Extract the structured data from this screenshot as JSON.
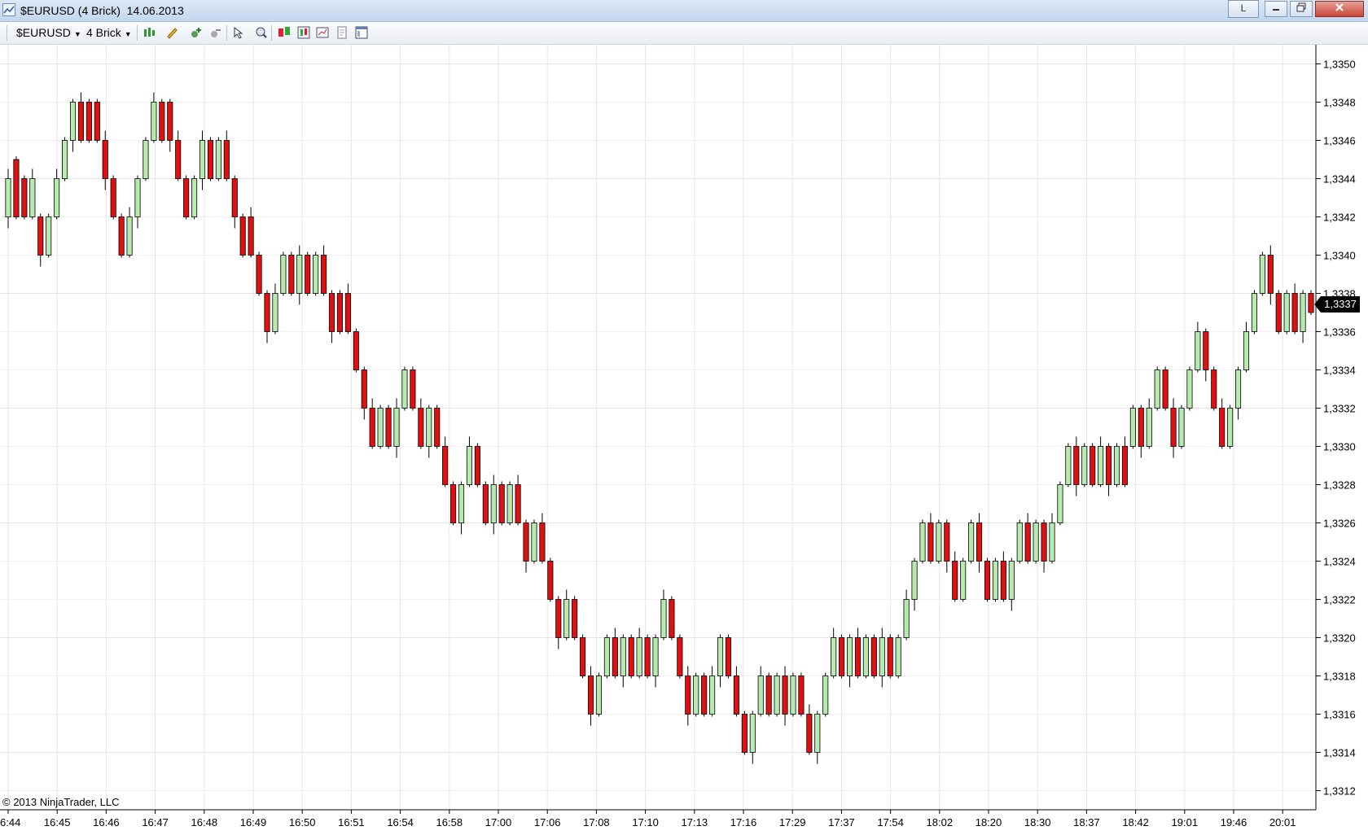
{
  "window": {
    "title": "$EURUSD (4 Brick)  14.06.2013",
    "button_l": "L"
  },
  "toolbar": {
    "instrument": "$EURUSD",
    "period": "4 Brick"
  },
  "chart_data": {
    "type": "renko candlestick",
    "instrument": "$EURUSD",
    "brick_size": "4 Brick",
    "date": "14.06.2013",
    "brick_pips": 0.0004,
    "last_price_label": "1,3337",
    "y_ticks": [
      "1,3350",
      "1,3348",
      "1,3346",
      "1,3344",
      "1,3342",
      "1,3340",
      "1,3338",
      "1,3336",
      "1,3334",
      "1,3332",
      "1,3330",
      "1,3328",
      "1,3326",
      "1,3324",
      "1,3322",
      "1,3320",
      "1,3318",
      "1,3316",
      "1,3314",
      "1,3312"
    ],
    "ylim": [
      1.3311,
      1.3351
    ],
    "x_ticks": [
      "6:44",
      "16:45",
      "16:46",
      "16:47",
      "16:48",
      "16:49",
      "16:50",
      "16:51",
      "16:54",
      "16:58",
      "17:00",
      "17:06",
      "17:08",
      "17:10",
      "17:13",
      "17:16",
      "17:29",
      "17:37",
      "17:54",
      "18:02",
      "18:20",
      "18:30",
      "18:37",
      "18:42",
      "19:01",
      "19:46",
      "20:01"
    ],
    "grid": true,
    "up_color": "#b8eab0",
    "down_color": "#e01010",
    "bricks": [
      {
        "dir": "up",
        "open": 1.3342,
        "close": 1.3344
      },
      {
        "dir": "down",
        "open": 1.3345,
        "close": 1.3342
      },
      {
        "dir": "down",
        "open": 1.3344,
        "close": 1.3342
      },
      {
        "dir": "up",
        "open": 1.3342,
        "close": 1.3344
      },
      {
        "dir": "down",
        "open": 1.3342,
        "close": 1.334
      },
      {
        "dir": "up",
        "open": 1.334,
        "close": 1.3342
      },
      {
        "dir": "up",
        "open": 1.3342,
        "close": 1.3344
      },
      {
        "dir": "up",
        "open": 1.3344,
        "close": 1.3346
      },
      {
        "dir": "up",
        "open": 1.3346,
        "close": 1.3348
      },
      {
        "dir": "down",
        "open": 1.3348,
        "close": 1.3346
      },
      {
        "dir": "down",
        "open": 1.3348,
        "close": 1.3346
      },
      {
        "dir": "down",
        "open": 1.3348,
        "close": 1.3346
      },
      {
        "dir": "down",
        "open": 1.3346,
        "close": 1.3344
      },
      {
        "dir": "down",
        "open": 1.3344,
        "close": 1.3342
      },
      {
        "dir": "down",
        "open": 1.3342,
        "close": 1.334
      },
      {
        "dir": "up",
        "open": 1.334,
        "close": 1.3342
      },
      {
        "dir": "up",
        "open": 1.3342,
        "close": 1.3344
      },
      {
        "dir": "up",
        "open": 1.3344,
        "close": 1.3346
      },
      {
        "dir": "up",
        "open": 1.3346,
        "close": 1.3348
      },
      {
        "dir": "down",
        "open": 1.3348,
        "close": 1.3346
      },
      {
        "dir": "down",
        "open": 1.3348,
        "close": 1.3346
      },
      {
        "dir": "down",
        "open": 1.3346,
        "close": 1.3344
      },
      {
        "dir": "down",
        "open": 1.3344,
        "close": 1.3342
      },
      {
        "dir": "up",
        "open": 1.3342,
        "close": 1.3344
      },
      {
        "dir": "up",
        "open": 1.3344,
        "close": 1.3346
      },
      {
        "dir": "down",
        "open": 1.3346,
        "close": 1.3344
      },
      {
        "dir": "up",
        "open": 1.3344,
        "close": 1.3346
      },
      {
        "dir": "down",
        "open": 1.3346,
        "close": 1.3344
      },
      {
        "dir": "down",
        "open": 1.3344,
        "close": 1.3342
      },
      {
        "dir": "down",
        "open": 1.3342,
        "close": 1.334
      },
      {
        "dir": "down",
        "open": 1.3342,
        "close": 1.334
      },
      {
        "dir": "down",
        "open": 1.334,
        "close": 1.3338
      },
      {
        "dir": "down",
        "open": 1.3338,
        "close": 1.3336
      },
      {
        "dir": "up",
        "open": 1.3336,
        "close": 1.3338
      },
      {
        "dir": "up",
        "open": 1.3338,
        "close": 1.334
      },
      {
        "dir": "down",
        "open": 1.334,
        "close": 1.3338
      },
      {
        "dir": "up",
        "open": 1.3338,
        "close": 1.334
      },
      {
        "dir": "down",
        "open": 1.334,
        "close": 1.3338
      },
      {
        "dir": "up",
        "open": 1.3338,
        "close": 1.334
      },
      {
        "dir": "down",
        "open": 1.334,
        "close": 1.3338
      },
      {
        "dir": "down",
        "open": 1.3338,
        "close": 1.3336
      },
      {
        "dir": "down",
        "open": 1.3338,
        "close": 1.3336
      },
      {
        "dir": "down",
        "open": 1.3338,
        "close": 1.3336
      },
      {
        "dir": "down",
        "open": 1.3336,
        "close": 1.3334
      },
      {
        "dir": "down",
        "open": 1.3334,
        "close": 1.3332
      },
      {
        "dir": "down",
        "open": 1.3332,
        "close": 1.333
      },
      {
        "dir": "up",
        "open": 1.333,
        "close": 1.3332
      },
      {
        "dir": "down",
        "open": 1.3332,
        "close": 1.333
      },
      {
        "dir": "up",
        "open": 1.333,
        "close": 1.3332
      },
      {
        "dir": "up",
        "open": 1.3332,
        "close": 1.3334
      },
      {
        "dir": "down",
        "open": 1.3334,
        "close": 1.3332
      },
      {
        "dir": "down",
        "open": 1.3332,
        "close": 1.333
      },
      {
        "dir": "up",
        "open": 1.333,
        "close": 1.3332
      },
      {
        "dir": "down",
        "open": 1.3332,
        "close": 1.333
      },
      {
        "dir": "down",
        "open": 1.333,
        "close": 1.3328
      },
      {
        "dir": "down",
        "open": 1.3328,
        "close": 1.3326
      },
      {
        "dir": "up",
        "open": 1.3326,
        "close": 1.3328
      },
      {
        "dir": "up",
        "open": 1.3328,
        "close": 1.333
      },
      {
        "dir": "down",
        "open": 1.333,
        "close": 1.3328
      },
      {
        "dir": "down",
        "open": 1.3328,
        "close": 1.3326
      },
      {
        "dir": "up",
        "open": 1.3326,
        "close": 1.3328
      },
      {
        "dir": "down",
        "open": 1.3328,
        "close": 1.3326
      },
      {
        "dir": "up",
        "open": 1.3326,
        "close": 1.3328
      },
      {
        "dir": "down",
        "open": 1.3328,
        "close": 1.3326
      },
      {
        "dir": "down",
        "open": 1.3326,
        "close": 1.3324
      },
      {
        "dir": "up",
        "open": 1.3324,
        "close": 1.3326
      },
      {
        "dir": "down",
        "open": 1.3326,
        "close": 1.3324
      },
      {
        "dir": "down",
        "open": 1.3324,
        "close": 1.3322
      },
      {
        "dir": "down",
        "open": 1.3322,
        "close": 1.332
      },
      {
        "dir": "up",
        "open": 1.332,
        "close": 1.3322
      },
      {
        "dir": "down",
        "open": 1.3322,
        "close": 1.332
      },
      {
        "dir": "down",
        "open": 1.332,
        "close": 1.3318
      },
      {
        "dir": "down",
        "open": 1.3318,
        "close": 1.3316
      },
      {
        "dir": "up",
        "open": 1.3316,
        "close": 1.3318
      },
      {
        "dir": "up",
        "open": 1.3318,
        "close": 1.332
      },
      {
        "dir": "down",
        "open": 1.332,
        "close": 1.3318
      },
      {
        "dir": "up",
        "open": 1.3318,
        "close": 1.332
      },
      {
        "dir": "down",
        "open": 1.332,
        "close": 1.3318
      },
      {
        "dir": "up",
        "open": 1.3318,
        "close": 1.332
      },
      {
        "dir": "down",
        "open": 1.332,
        "close": 1.3318
      },
      {
        "dir": "up",
        "open": 1.3318,
        "close": 1.332
      },
      {
        "dir": "up",
        "open": 1.332,
        "close": 1.3322
      },
      {
        "dir": "down",
        "open": 1.3322,
        "close": 1.332
      },
      {
        "dir": "down",
        "open": 1.332,
        "close": 1.3318
      },
      {
        "dir": "down",
        "open": 1.3318,
        "close": 1.3316
      },
      {
        "dir": "up",
        "open": 1.3316,
        "close": 1.3318
      },
      {
        "dir": "down",
        "open": 1.3318,
        "close": 1.3316
      },
      {
        "dir": "up",
        "open": 1.3316,
        "close": 1.3318
      },
      {
        "dir": "up",
        "open": 1.3318,
        "close": 1.332
      },
      {
        "dir": "down",
        "open": 1.332,
        "close": 1.3318
      },
      {
        "dir": "down",
        "open": 1.3318,
        "close": 1.3316
      },
      {
        "dir": "down",
        "open": 1.3316,
        "close": 1.3314
      },
      {
        "dir": "up",
        "open": 1.3314,
        "close": 1.3316
      },
      {
        "dir": "up",
        "open": 1.3316,
        "close": 1.3318
      },
      {
        "dir": "down",
        "open": 1.3318,
        "close": 1.3316
      },
      {
        "dir": "up",
        "open": 1.3316,
        "close": 1.3318
      },
      {
        "dir": "down",
        "open": 1.3318,
        "close": 1.3316
      },
      {
        "dir": "up",
        "open": 1.3316,
        "close": 1.3318
      },
      {
        "dir": "down",
        "open": 1.3318,
        "close": 1.3316
      },
      {
        "dir": "down",
        "open": 1.3316,
        "close": 1.3314
      },
      {
        "dir": "up",
        "open": 1.3314,
        "close": 1.3316
      },
      {
        "dir": "up",
        "open": 1.3316,
        "close": 1.3318
      },
      {
        "dir": "up",
        "open": 1.3318,
        "close": 1.332
      },
      {
        "dir": "down",
        "open": 1.332,
        "close": 1.3318
      },
      {
        "dir": "up",
        "open": 1.3318,
        "close": 1.332
      },
      {
        "dir": "down",
        "open": 1.332,
        "close": 1.3318
      },
      {
        "dir": "up",
        "open": 1.3318,
        "close": 1.332
      },
      {
        "dir": "down",
        "open": 1.332,
        "close": 1.3318
      },
      {
        "dir": "up",
        "open": 1.3318,
        "close": 1.332
      },
      {
        "dir": "down",
        "open": 1.332,
        "close": 1.3318
      },
      {
        "dir": "up",
        "open": 1.3318,
        "close": 1.332
      },
      {
        "dir": "up",
        "open": 1.332,
        "close": 1.3322
      },
      {
        "dir": "up",
        "open": 1.3322,
        "close": 1.3324
      },
      {
        "dir": "up",
        "open": 1.3324,
        "close": 1.3326
      },
      {
        "dir": "down",
        "open": 1.3326,
        "close": 1.3324
      },
      {
        "dir": "up",
        "open": 1.3324,
        "close": 1.3326
      },
      {
        "dir": "down",
        "open": 1.3326,
        "close": 1.3324
      },
      {
        "dir": "down",
        "open": 1.3324,
        "close": 1.3322
      },
      {
        "dir": "up",
        "open": 1.3322,
        "close": 1.3324
      },
      {
        "dir": "up",
        "open": 1.3324,
        "close": 1.3326
      },
      {
        "dir": "down",
        "open": 1.3326,
        "close": 1.3324
      },
      {
        "dir": "down",
        "open": 1.3324,
        "close": 1.3322
      },
      {
        "dir": "up",
        "open": 1.3322,
        "close": 1.3324
      },
      {
        "dir": "down",
        "open": 1.3324,
        "close": 1.3322
      },
      {
        "dir": "up",
        "open": 1.3322,
        "close": 1.3324
      },
      {
        "dir": "up",
        "open": 1.3324,
        "close": 1.3326
      },
      {
        "dir": "down",
        "open": 1.3326,
        "close": 1.3324
      },
      {
        "dir": "up",
        "open": 1.3324,
        "close": 1.3326
      },
      {
        "dir": "down",
        "open": 1.3326,
        "close": 1.3324
      },
      {
        "dir": "up",
        "open": 1.3324,
        "close": 1.3326
      },
      {
        "dir": "up",
        "open": 1.3326,
        "close": 1.3328
      },
      {
        "dir": "up",
        "open": 1.3328,
        "close": 1.333
      },
      {
        "dir": "down",
        "open": 1.333,
        "close": 1.3328
      },
      {
        "dir": "up",
        "open": 1.3328,
        "close": 1.333
      },
      {
        "dir": "down",
        "open": 1.333,
        "close": 1.3328
      },
      {
        "dir": "up",
        "open": 1.3328,
        "close": 1.333
      },
      {
        "dir": "down",
        "open": 1.333,
        "close": 1.3328
      },
      {
        "dir": "up",
        "open": 1.3328,
        "close": 1.333
      },
      {
        "dir": "down",
        "open": 1.333,
        "close": 1.3328
      },
      {
        "dir": "up",
        "open": 1.333,
        "close": 1.3332
      },
      {
        "dir": "down",
        "open": 1.3332,
        "close": 1.333
      },
      {
        "dir": "up",
        "open": 1.333,
        "close": 1.3332
      },
      {
        "dir": "up",
        "open": 1.3332,
        "close": 1.3334
      },
      {
        "dir": "down",
        "open": 1.3334,
        "close": 1.3332
      },
      {
        "dir": "down",
        "open": 1.3332,
        "close": 1.333
      },
      {
        "dir": "up",
        "open": 1.333,
        "close": 1.3332
      },
      {
        "dir": "up",
        "open": 1.3332,
        "close": 1.3334
      },
      {
        "dir": "up",
        "open": 1.3334,
        "close": 1.3336
      },
      {
        "dir": "down",
        "open": 1.3336,
        "close": 1.3334
      },
      {
        "dir": "down",
        "open": 1.3334,
        "close": 1.3332
      },
      {
        "dir": "down",
        "open": 1.3332,
        "close": 1.333
      },
      {
        "dir": "up",
        "open": 1.333,
        "close": 1.3332
      },
      {
        "dir": "up",
        "open": 1.3332,
        "close": 1.3334
      },
      {
        "dir": "up",
        "open": 1.3334,
        "close": 1.3336
      },
      {
        "dir": "up",
        "open": 1.3336,
        "close": 1.3338
      },
      {
        "dir": "up",
        "open": 1.3338,
        "close": 1.334
      },
      {
        "dir": "down",
        "open": 1.334,
        "close": 1.3338
      },
      {
        "dir": "down",
        "open": 1.3338,
        "close": 1.3336
      },
      {
        "dir": "up",
        "open": 1.3336,
        "close": 1.3338
      },
      {
        "dir": "down",
        "open": 1.3338,
        "close": 1.3336
      },
      {
        "dir": "up",
        "open": 1.3336,
        "close": 1.3338
      },
      {
        "dir": "down",
        "open": 1.3338,
        "close": 1.3337
      }
    ]
  },
  "footer": {
    "copyright": "© 2013 NinjaTrader, LLC"
  }
}
